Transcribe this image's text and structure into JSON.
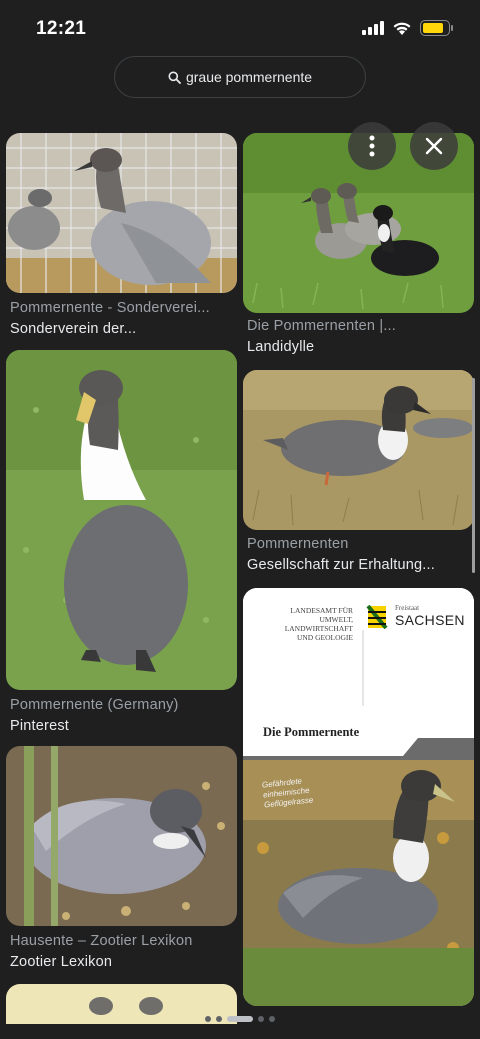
{
  "status_bar": {
    "time": "12:21",
    "battery_level": 0.85
  },
  "search": {
    "query": "graue pommernente",
    "icon": "search-icon"
  },
  "overlay": {
    "menu_icon": "more-vert-icon",
    "close_icon": "close-icon"
  },
  "results": [
    {
      "title": "Pommernente - Sonderverei...",
      "source": "Sonderverein der..."
    },
    {
      "title": "Die Pommernenten |...",
      "source": "Landidylle"
    },
    {
      "title": "Pommernente (Germany)",
      "source": "Pinterest"
    },
    {
      "title": "Pommernenten",
      "source": "Gesellschaft zur Erhaltung..."
    },
    {
      "title": "Hausente – Zootier Lexikon",
      "source": "Zootier Lexikon"
    }
  ],
  "brochure": {
    "agency_line1": "LANDESAMT FÜR UMWELT,",
    "agency_line2": "LANDWIRTSCHAFT",
    "agency_line3": "UND GEOLOGIE",
    "state_small": "Freistaat",
    "state_big": "SACHSEN",
    "heading": "Die Pommernente",
    "tag1": "Gefährdete",
    "tag2": "einheimische",
    "tag3": "Geflügelrasse"
  },
  "colors": {
    "background": "#1f1f1f",
    "secondary_text": "#9aa0a6",
    "primary_text": "#e8eaed",
    "battery": "#ffd60a"
  }
}
